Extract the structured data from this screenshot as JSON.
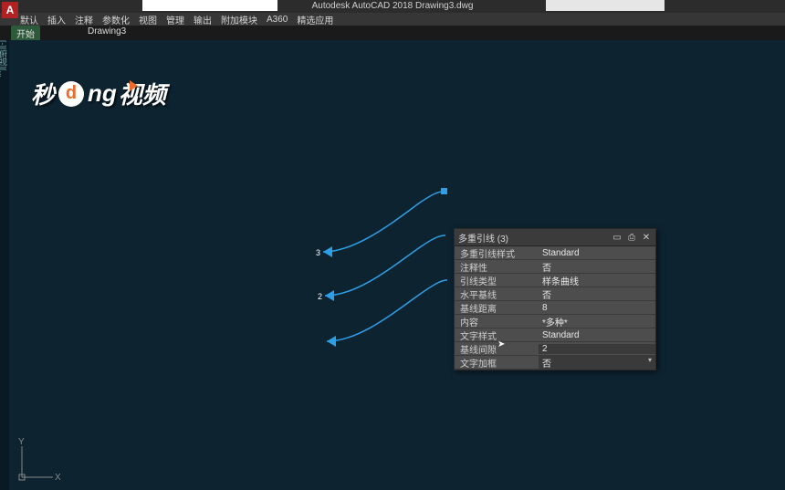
{
  "app": {
    "title": "Autodesk AutoCAD 2018   Drawing3.dwg"
  },
  "app_icon": "A",
  "menu": [
    "默认",
    "插入",
    "注释",
    "参数化",
    "视图",
    "管理",
    "输出",
    "附加模块",
    "A360",
    "精选应用"
  ],
  "tabs": {
    "start": "开始",
    "doc": "Drawing3"
  },
  "side_label": "[-][俯视][...",
  "axis": {
    "x": "X",
    "y": "Y"
  },
  "panel": {
    "title": "多重引线 (3)",
    "rows": [
      {
        "k": "多重引线样式",
        "v": "Standard",
        "type": "text"
      },
      {
        "k": "注释性",
        "v": "否",
        "type": "text"
      },
      {
        "k": "引线类型",
        "v": "样条曲线",
        "type": "text"
      },
      {
        "k": "水平基线",
        "v": "否",
        "type": "text"
      },
      {
        "k": "基线距离",
        "v": "8",
        "type": "text"
      },
      {
        "k": "内容",
        "v": "*多种*",
        "type": "text"
      },
      {
        "k": "文字样式",
        "v": "Standard",
        "type": "text"
      },
      {
        "k": "基线间隙",
        "v": "2",
        "type": "input"
      },
      {
        "k": "文字加框",
        "v": "否",
        "type": "dd"
      }
    ]
  },
  "watermark": {
    "a": "秒",
    "b": "d",
    "c": "ng",
    "d": "视频"
  },
  "labels": {
    "l1": "3",
    "l2": "2"
  }
}
